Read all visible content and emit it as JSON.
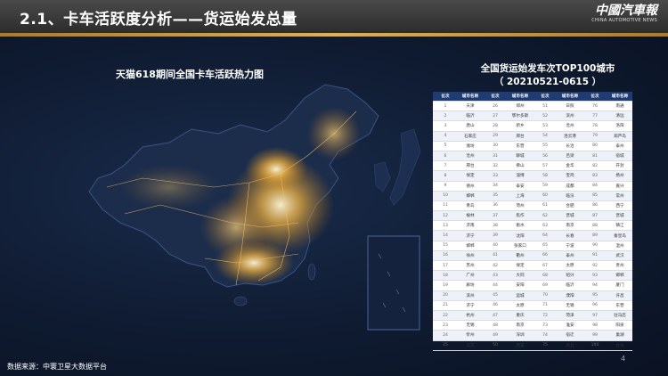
{
  "header": {
    "title": "2.1、卡车活跃度分析——货运始发总量"
  },
  "logo": {
    "cn": "中國汽車報",
    "en": "CHINA AUTOMOTIVE NEWS"
  },
  "map": {
    "title": "天猫618期间全国卡车活跃热力图"
  },
  "table": {
    "title_line1": "全国货运始发车次TOP100城市",
    "title_line2": "（ 20210521-0615 ）",
    "headers": [
      "位次",
      "城市名称",
      "位次",
      "城市名称",
      "位次",
      "城市名称",
      "位次",
      "城市名称"
    ],
    "rows": [
      [
        "1",
        "天津",
        "26",
        "郑州",
        "51",
        "日照",
        "76",
        "南通"
      ],
      [
        "2",
        "临沂",
        "27",
        "鄂尔多斯",
        "52",
        "滨州",
        "77",
        "清远"
      ],
      [
        "3",
        "唐山",
        "28",
        "新乡",
        "53",
        "沧州",
        "78",
        "洛阳"
      ],
      [
        "4",
        "石家庄",
        "29",
        "邢台",
        "54",
        "连云港",
        "79",
        "葫芦岛"
      ],
      [
        "5",
        "潍坊",
        "30",
        "东营",
        "55",
        "长治",
        "80",
        "泰州"
      ],
      [
        "6",
        "沧州",
        "31",
        "聊城",
        "56",
        "吕梁",
        "81",
        "宿城"
      ],
      [
        "7",
        "邢台",
        "32",
        "佛山",
        "57",
        "金华",
        "82",
        "开封"
      ],
      [
        "8",
        "保定",
        "33",
        "淄博",
        "58",
        "宝鸡",
        "83",
        "扬州"
      ],
      [
        "9",
        "德州",
        "34",
        "泰安",
        "59",
        "成都",
        "84",
        "嘉兴"
      ],
      [
        "10",
        "邯郸",
        "35",
        "上海",
        "60",
        "临汾",
        "85",
        "常州"
      ],
      [
        "11",
        "青岛",
        "36",
        "菏州",
        "61",
        "合肥",
        "86",
        "西宁"
      ],
      [
        "12",
        "榆林",
        "37",
        "焦作",
        "62",
        "晋城",
        "87",
        "晋城"
      ],
      [
        "13",
        "济南",
        "38",
        "衡水",
        "63",
        "南京",
        "88",
        "镇江"
      ],
      [
        "14",
        "济宁",
        "39",
        "沈阳",
        "64",
        "长春",
        "89",
        "秦皇岛"
      ],
      [
        "15",
        "邯郸",
        "40",
        "张家口",
        "65",
        "宁波",
        "90",
        "温州"
      ],
      [
        "16",
        "徐州",
        "41",
        "衢州",
        "66",
        "泰州",
        "91",
        "武汉"
      ],
      [
        "17",
        "苏州",
        "42",
        "保定",
        "67",
        "太原",
        "92",
        "贵州"
      ],
      [
        "18",
        "广州",
        "43",
        "大同",
        "68",
        "绍兴",
        "93",
        "邯郸"
      ],
      [
        "19",
        "廊坊",
        "44",
        "安阳",
        "69",
        "临沂",
        "94",
        "厦门"
      ],
      [
        "20",
        "滨州",
        "45",
        "运城",
        "70",
        "濮阳",
        "95",
        "许昌"
      ],
      [
        "21",
        "济宁",
        "46",
        "太原",
        "71",
        "无锡",
        "96",
        "东营"
      ],
      [
        "22",
        "杭州",
        "47",
        "重庆",
        "72",
        "菏泽",
        "97",
        "驻马店"
      ],
      [
        "23",
        "无锡",
        "48",
        "南京",
        "73",
        "淮安",
        "98",
        "阳泉"
      ],
      [
        "24",
        "忻州",
        "49",
        "深圳",
        "74",
        "宿迁",
        "99",
        "巢湖"
      ],
      [
        "25",
        "北京",
        "50",
        "西安",
        "75",
        "商丘",
        "100",
        "台州"
      ]
    ]
  },
  "footer": {
    "source": "数据来源：中寰卫星大数据平台",
    "page": "4"
  }
}
